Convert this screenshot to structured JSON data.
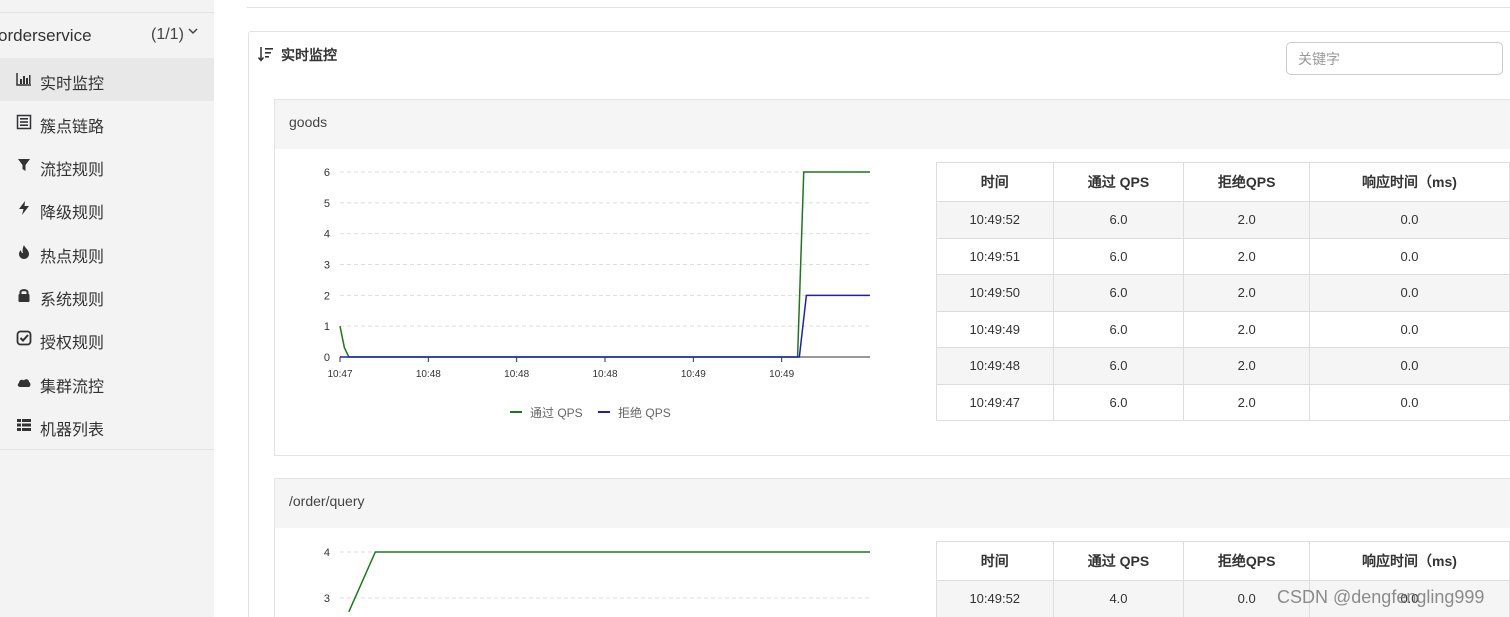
{
  "sidebar": {
    "app_name": "orderservice",
    "app_count": "(1/1)",
    "items": [
      {
        "label": "实时监控",
        "icon": "bar-chart-icon",
        "active": true
      },
      {
        "label": "簇点链路",
        "icon": "list-icon"
      },
      {
        "label": "流控规则",
        "icon": "filter-icon"
      },
      {
        "label": "降级规则",
        "icon": "flash-icon"
      },
      {
        "label": "热点规则",
        "icon": "fire-icon"
      },
      {
        "label": "系统规则",
        "icon": "lock-icon"
      },
      {
        "label": "授权规则",
        "icon": "check-square-icon"
      },
      {
        "label": "集群流控",
        "icon": "cloud-icon"
      },
      {
        "label": "机器列表",
        "icon": "table-icon"
      }
    ]
  },
  "panel": {
    "title": "实时监控",
    "search_placeholder": "关键字"
  },
  "colors": {
    "pass": "#1a7a1a",
    "block": "#1f1fb8"
  },
  "legend": {
    "pass_label": "通过 QPS",
    "block_label": "拒绝 QPS"
  },
  "table_headers": [
    "时间",
    "通过 QPS",
    "拒绝QPS",
    "响应时间（ms)"
  ],
  "resources": [
    {
      "name": "goods",
      "rows": [
        [
          "10:49:52",
          "6.0",
          "2.0",
          "0.0"
        ],
        [
          "10:49:51",
          "6.0",
          "2.0",
          "0.0"
        ],
        [
          "10:49:50",
          "6.0",
          "2.0",
          "0.0"
        ],
        [
          "10:49:49",
          "6.0",
          "2.0",
          "0.0"
        ],
        [
          "10:49:48",
          "6.0",
          "2.0",
          "0.0"
        ],
        [
          "10:49:47",
          "6.0",
          "2.0",
          "0.0"
        ]
      ]
    },
    {
      "name": "/order/query",
      "rows": [
        [
          "10:49:52",
          "4.0",
          "0.0",
          "0.0"
        ]
      ]
    }
  ],
  "chart_data": [
    {
      "type": "line",
      "title": "",
      "xlabel": "",
      "ylabel": "",
      "x_tick_labels": [
        "10:47",
        "10:48",
        "10:48",
        "10:48",
        "10:49",
        "10:49"
      ],
      "y_ticks": [
        0,
        1,
        2,
        3,
        4,
        5,
        6
      ],
      "ylim": [
        0,
        6
      ],
      "xlim": [
        0,
        60
      ],
      "grid": true,
      "legend": "bottom",
      "series": [
        {
          "name": "通过 QPS",
          "color": "#1a7a1a",
          "x": [
            0,
            0.5,
            1,
            51,
            51.8,
            52.5,
            60
          ],
          "y": [
            1,
            0.3,
            0,
            0,
            0,
            6,
            6
          ]
        },
        {
          "name": "拒绝 QPS",
          "color": "#1f1fb8",
          "x": [
            0,
            51,
            52,
            52.8,
            60
          ],
          "y": [
            0,
            0,
            0,
            2,
            2
          ]
        }
      ]
    },
    {
      "type": "line",
      "title": "",
      "xlabel": "",
      "ylabel": "",
      "y_ticks": [
        3,
        4
      ],
      "ylim": [
        0,
        4
      ],
      "xlim": [
        0,
        60
      ],
      "grid": true,
      "series": [
        {
          "name": "通过 QPS",
          "color": "#1a7a1a",
          "x": [
            1,
            4,
            60
          ],
          "y": [
            2.7,
            4,
            4
          ]
        }
      ]
    }
  ],
  "watermark": "CSDN @dengfengling999"
}
